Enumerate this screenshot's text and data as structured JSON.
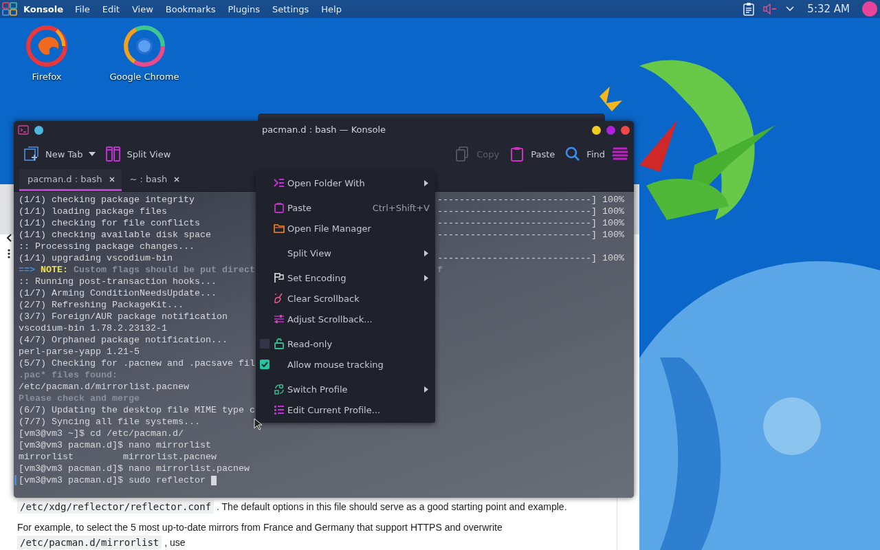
{
  "panel": {
    "app_name": "Konsole",
    "menus": [
      "File",
      "Edit",
      "View",
      "Bookmarks",
      "Plugins",
      "Settings",
      "Help"
    ],
    "clock": "5:32 AM"
  },
  "desktop_icons": [
    {
      "label": "Firefox"
    },
    {
      "label": "Google Chrome"
    }
  ],
  "browser": {
    "paragraphs": [
      [
        {
          "text": "/etc/xdg/reflector/reflector.conf",
          "code": true
        },
        {
          "text": " . The default options in this file should serve as a good starting point and example.",
          "code": false
        }
      ],
      [
        {
          "text": "For example, to select the 5 most up-to-date mirrors from France and Germany that support HTTPS and overwrite ",
          "code": false
        },
        {
          "text": "/etc/pacman.d/mirrorlist",
          "code": true
        },
        {
          "text": " , use",
          "code": false
        }
      ]
    ]
  },
  "konsole": {
    "title": "pacman.d : bash — Konsole",
    "toolbar_left": [
      {
        "label": "New Tab",
        "disabled": false,
        "dropdown": true
      },
      {
        "label": "Split View",
        "disabled": false,
        "dropdown": false
      }
    ],
    "toolbar_right": [
      {
        "label": "Copy",
        "disabled": true,
        "dropdown": false
      },
      {
        "label": "Paste",
        "disabled": false,
        "dropdown": false
      },
      {
        "label": "Find",
        "disabled": false,
        "dropdown": false
      }
    ],
    "tabs": [
      {
        "label": "pacman.d : bash",
        "selected": true
      },
      {
        "label": "~ : bash",
        "selected": false
      }
    ],
    "terminal": {
      "lines": [
        {
          "segments": [
            {
              "text": "(1/1) checking package integrity",
              "kind": "normal"
            }
          ],
          "tail": {
            "text": "----------------------------] 100%",
            "kind": "normal"
          }
        },
        {
          "segments": [
            {
              "text": "(1/1) loading package files",
              "kind": "normal"
            }
          ],
          "tail": {
            "text": "----------------------------] 100%",
            "kind": "normal"
          }
        },
        {
          "segments": [
            {
              "text": "(1/1) checking for file conflicts",
              "kind": "normal"
            }
          ],
          "tail": {
            "text": "----------------------------] 100%",
            "kind": "normal"
          }
        },
        {
          "segments": [
            {
              "text": "(1/1) checking available disk space",
              "kind": "normal"
            }
          ],
          "tail": {
            "text": "----------------------------] 100%",
            "kind": "normal"
          }
        },
        {
          "segments": [
            {
              "text": ":: Processing package changes...",
              "kind": "normal"
            }
          ]
        },
        {
          "segments": [
            {
              "text": "(1/1) upgrading vscodium-bin",
              "kind": "normal"
            }
          ],
          "tail": {
            "text": "----------------------------] 100%",
            "kind": "normal"
          }
        },
        {
          "segments": [
            {
              "text": "==>",
              "kind": "arrow"
            },
            {
              "text": " NOTE:",
              "kind": "note"
            },
            {
              "text": " Custom flags should be put direct",
              "kind": "dim"
            }
          ],
          "tail": {
            "text": "f",
            "kind": "dim"
          }
        },
        {
          "segments": [
            {
              "text": ":: Running post-transaction hooks...",
              "kind": "normal"
            }
          ]
        },
        {
          "segments": [
            {
              "text": "(1/7) Arming ConditionNeedsUpdate...",
              "kind": "normal"
            }
          ]
        },
        {
          "segments": [
            {
              "text": "(2/7) Refreshing PackageKit...",
              "kind": "normal"
            }
          ]
        },
        {
          "segments": [
            {
              "text": "(3/7) Foreign/AUR package notification",
              "kind": "normal"
            }
          ]
        },
        {
          "segments": [
            {
              "text": "vscodium-bin 1.78.2.23132-1",
              "kind": "normal"
            }
          ]
        },
        {
          "segments": [
            {
              "text": "(4/7) Orphaned package notification...",
              "kind": "normal"
            }
          ]
        },
        {
          "segments": [
            {
              "text": "perl-parse-yapp 1.21-5",
              "kind": "normal"
            }
          ]
        },
        {
          "segments": [
            {
              "text": "(5/7) Checking for .pacnew and .pacsave fil",
              "kind": "normal"
            }
          ]
        },
        {
          "segments": [
            {
              "text": ".pac* files found:",
              "kind": "dim"
            }
          ]
        },
        {
          "segments": [
            {
              "text": "/etc/pacman.d/mirrorlist.pacnew",
              "kind": "normal"
            }
          ]
        },
        {
          "segments": [
            {
              "text": "Please check and merge",
              "kind": "dim"
            }
          ]
        },
        {
          "segments": [
            {
              "text": "(6/7) Updating the desktop file MIME type c",
              "kind": "normal"
            }
          ]
        },
        {
          "segments": [
            {
              "text": "(7/7) Syncing all file systems...",
              "kind": "normal"
            }
          ]
        },
        {
          "segments": [
            {
              "text": "[vm3@vm3 ~]$ cd /etc/pacman.d/",
              "kind": "normal"
            }
          ]
        },
        {
          "segments": [
            {
              "text": "[vm3@vm3 pacman.d]$ nano mirrorlist",
              "kind": "normal"
            }
          ]
        },
        {
          "segments": [
            {
              "text": "mirrorlist         mirrorlist.pacnew",
              "kind": "normal"
            }
          ]
        },
        {
          "segments": [
            {
              "text": "[vm3@vm3 pacman.d]$ nano mirrorlist.pacnew",
              "kind": "normal"
            }
          ]
        },
        {
          "segments": [
            {
              "text": "[vm3@vm3 pacman.d]$ sudo reflector ",
              "kind": "normal"
            }
          ]
        }
      ]
    }
  },
  "context_menu": {
    "sections": [
      {
        "items": [
          {
            "kind": "action",
            "label": "Open Folder With",
            "submenu": true
          }
        ]
      },
      {
        "items": [
          {
            "kind": "action",
            "label": "Paste",
            "shortcut": "Ctrl+Shift+V",
            "submenu": false
          },
          {
            "kind": "action",
            "label": "Open File Manager",
            "submenu": false
          }
        ]
      },
      {
        "items": [
          {
            "kind": "action",
            "label": "Split View",
            "submenu": true
          }
        ]
      },
      {
        "items": [
          {
            "kind": "action",
            "label": "Set Encoding",
            "submenu": true
          },
          {
            "kind": "action",
            "label": "Clear Scrollback",
            "submenu": false
          },
          {
            "kind": "action",
            "label": "Adjust Scrollback...",
            "submenu": false
          }
        ]
      },
      {
        "items": [
          {
            "kind": "check",
            "label": "Read-only",
            "checked": false,
            "submenu": false
          },
          {
            "kind": "check",
            "label": "Allow mouse tracking",
            "checked": true,
            "submenu": false
          }
        ]
      },
      {
        "items": [
          {
            "kind": "action",
            "label": "Switch Profile",
            "submenu": true
          },
          {
            "kind": "action",
            "label": "Edit Current Profile...",
            "submenu": false
          }
        ]
      }
    ]
  }
}
